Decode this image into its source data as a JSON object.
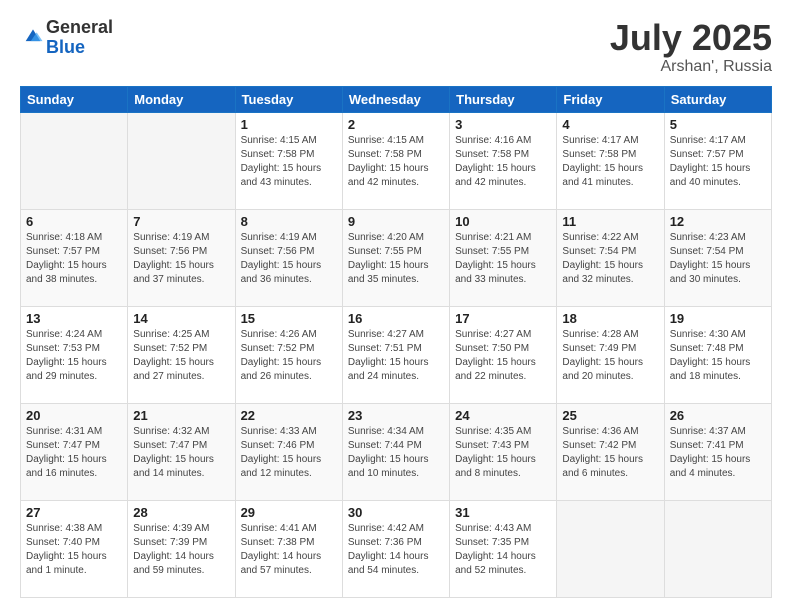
{
  "logo": {
    "general": "General",
    "blue": "Blue"
  },
  "header": {
    "month": "July 2025",
    "location": "Arshan', Russia"
  },
  "days_of_week": [
    "Sunday",
    "Monday",
    "Tuesday",
    "Wednesday",
    "Thursday",
    "Friday",
    "Saturday"
  ],
  "weeks": [
    [
      {
        "day": "",
        "content": ""
      },
      {
        "day": "",
        "content": ""
      },
      {
        "day": "1",
        "content": "Sunrise: 4:15 AM\nSunset: 7:58 PM\nDaylight: 15 hours\nand 43 minutes."
      },
      {
        "day": "2",
        "content": "Sunrise: 4:15 AM\nSunset: 7:58 PM\nDaylight: 15 hours\nand 42 minutes."
      },
      {
        "day": "3",
        "content": "Sunrise: 4:16 AM\nSunset: 7:58 PM\nDaylight: 15 hours\nand 42 minutes."
      },
      {
        "day": "4",
        "content": "Sunrise: 4:17 AM\nSunset: 7:58 PM\nDaylight: 15 hours\nand 41 minutes."
      },
      {
        "day": "5",
        "content": "Sunrise: 4:17 AM\nSunset: 7:57 PM\nDaylight: 15 hours\nand 40 minutes."
      }
    ],
    [
      {
        "day": "6",
        "content": "Sunrise: 4:18 AM\nSunset: 7:57 PM\nDaylight: 15 hours\nand 38 minutes."
      },
      {
        "day": "7",
        "content": "Sunrise: 4:19 AM\nSunset: 7:56 PM\nDaylight: 15 hours\nand 37 minutes."
      },
      {
        "day": "8",
        "content": "Sunrise: 4:19 AM\nSunset: 7:56 PM\nDaylight: 15 hours\nand 36 minutes."
      },
      {
        "day": "9",
        "content": "Sunrise: 4:20 AM\nSunset: 7:55 PM\nDaylight: 15 hours\nand 35 minutes."
      },
      {
        "day": "10",
        "content": "Sunrise: 4:21 AM\nSunset: 7:55 PM\nDaylight: 15 hours\nand 33 minutes."
      },
      {
        "day": "11",
        "content": "Sunrise: 4:22 AM\nSunset: 7:54 PM\nDaylight: 15 hours\nand 32 minutes."
      },
      {
        "day": "12",
        "content": "Sunrise: 4:23 AM\nSunset: 7:54 PM\nDaylight: 15 hours\nand 30 minutes."
      }
    ],
    [
      {
        "day": "13",
        "content": "Sunrise: 4:24 AM\nSunset: 7:53 PM\nDaylight: 15 hours\nand 29 minutes."
      },
      {
        "day": "14",
        "content": "Sunrise: 4:25 AM\nSunset: 7:52 PM\nDaylight: 15 hours\nand 27 minutes."
      },
      {
        "day": "15",
        "content": "Sunrise: 4:26 AM\nSunset: 7:52 PM\nDaylight: 15 hours\nand 26 minutes."
      },
      {
        "day": "16",
        "content": "Sunrise: 4:27 AM\nSunset: 7:51 PM\nDaylight: 15 hours\nand 24 minutes."
      },
      {
        "day": "17",
        "content": "Sunrise: 4:27 AM\nSunset: 7:50 PM\nDaylight: 15 hours\nand 22 minutes."
      },
      {
        "day": "18",
        "content": "Sunrise: 4:28 AM\nSunset: 7:49 PM\nDaylight: 15 hours\nand 20 minutes."
      },
      {
        "day": "19",
        "content": "Sunrise: 4:30 AM\nSunset: 7:48 PM\nDaylight: 15 hours\nand 18 minutes."
      }
    ],
    [
      {
        "day": "20",
        "content": "Sunrise: 4:31 AM\nSunset: 7:47 PM\nDaylight: 15 hours\nand 16 minutes."
      },
      {
        "day": "21",
        "content": "Sunrise: 4:32 AM\nSunset: 7:47 PM\nDaylight: 15 hours\nand 14 minutes."
      },
      {
        "day": "22",
        "content": "Sunrise: 4:33 AM\nSunset: 7:46 PM\nDaylight: 15 hours\nand 12 minutes."
      },
      {
        "day": "23",
        "content": "Sunrise: 4:34 AM\nSunset: 7:44 PM\nDaylight: 15 hours\nand 10 minutes."
      },
      {
        "day": "24",
        "content": "Sunrise: 4:35 AM\nSunset: 7:43 PM\nDaylight: 15 hours\nand 8 minutes."
      },
      {
        "day": "25",
        "content": "Sunrise: 4:36 AM\nSunset: 7:42 PM\nDaylight: 15 hours\nand 6 minutes."
      },
      {
        "day": "26",
        "content": "Sunrise: 4:37 AM\nSunset: 7:41 PM\nDaylight: 15 hours\nand 4 minutes."
      }
    ],
    [
      {
        "day": "27",
        "content": "Sunrise: 4:38 AM\nSunset: 7:40 PM\nDaylight: 15 hours\nand 1 minute."
      },
      {
        "day": "28",
        "content": "Sunrise: 4:39 AM\nSunset: 7:39 PM\nDaylight: 14 hours\nand 59 minutes."
      },
      {
        "day": "29",
        "content": "Sunrise: 4:41 AM\nSunset: 7:38 PM\nDaylight: 14 hours\nand 57 minutes."
      },
      {
        "day": "30",
        "content": "Sunrise: 4:42 AM\nSunset: 7:36 PM\nDaylight: 14 hours\nand 54 minutes."
      },
      {
        "day": "31",
        "content": "Sunrise: 4:43 AM\nSunset: 7:35 PM\nDaylight: 14 hours\nand 52 minutes."
      },
      {
        "day": "",
        "content": ""
      },
      {
        "day": "",
        "content": ""
      }
    ]
  ]
}
